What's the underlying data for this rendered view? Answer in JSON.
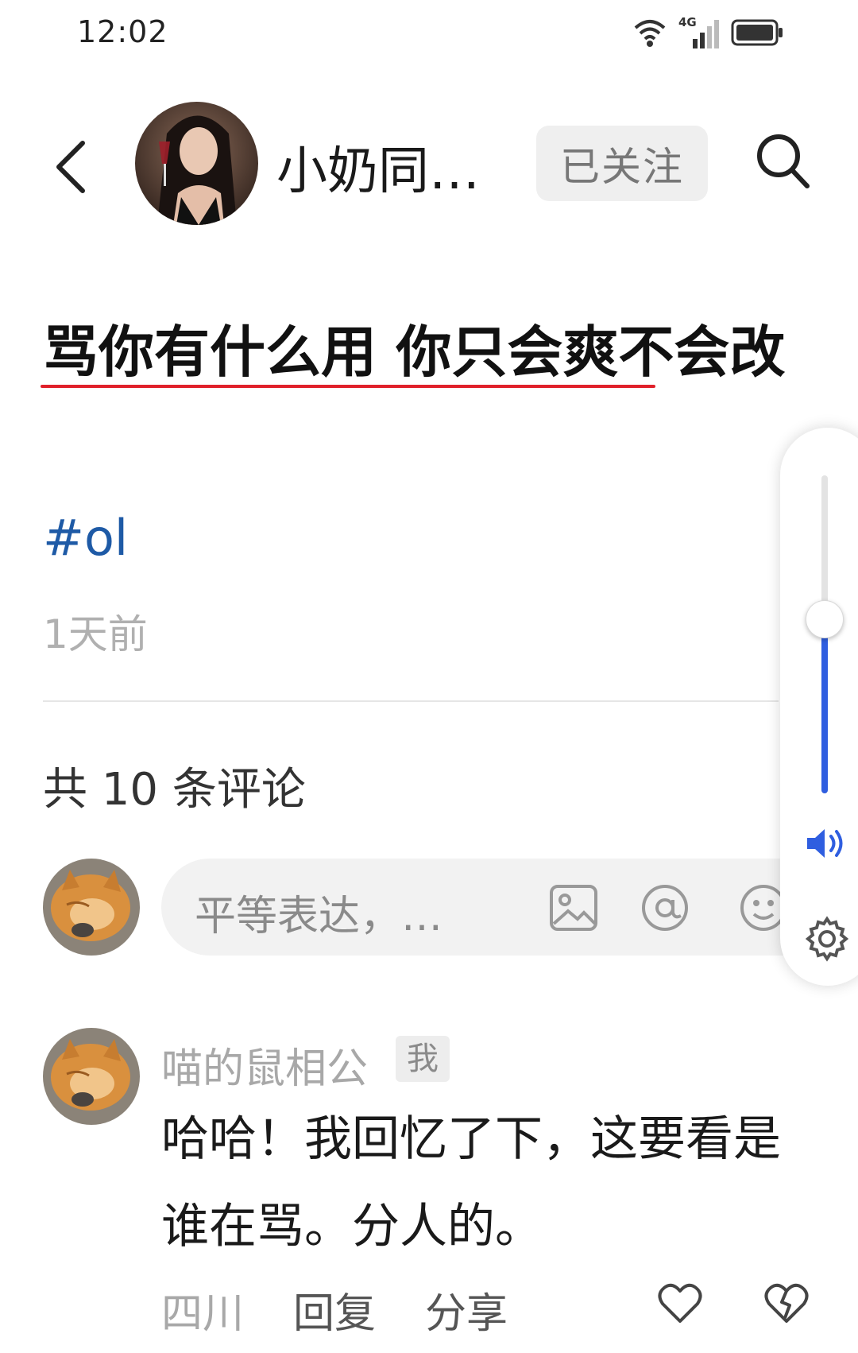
{
  "status_bar": {
    "time": "12:02",
    "network": "4G"
  },
  "header": {
    "author_name": "小奶同…",
    "follow_label": "已关注"
  },
  "post": {
    "title": "骂你有什么用 你只会爽不会改",
    "hashtag": "#ol",
    "time": "1天前"
  },
  "comments_section": {
    "count_label": "共 10 条评论",
    "input_placeholder": "平等表达，…"
  },
  "comment": {
    "user": "喵的鼠相公",
    "badge": "我",
    "text": "哈哈！我回忆了下，这要看是谁在骂。分人的。",
    "location": "四川",
    "reply_label": "回复",
    "share_label": "分享"
  },
  "volume": {
    "level": 0.55
  },
  "colors": {
    "accent_blue": "#2f5ee0",
    "hashtag_blue": "#1e5aa6",
    "underline_red": "#e0202a"
  }
}
